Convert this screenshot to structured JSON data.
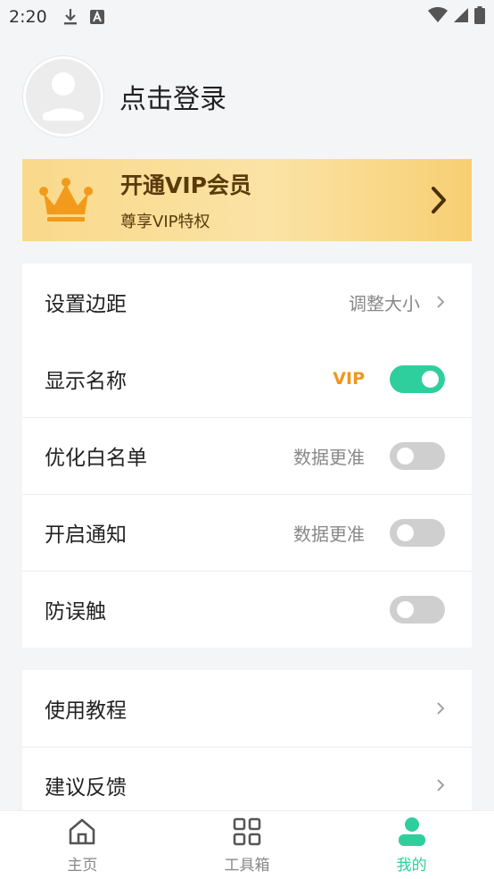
{
  "status_bar": {
    "time": "2:20",
    "icons": [
      "download-icon",
      "a-notification-icon",
      "wifi-icon",
      "signal-icon",
      "battery-icon"
    ]
  },
  "profile": {
    "login_text": "点击登录",
    "avatar_icon": "user-avatar-icon"
  },
  "vip_banner": {
    "title": "开通VIP会员",
    "subtitle": "尊享VIP特权",
    "icon": "crown-icon",
    "crown_color": "#f29a1b"
  },
  "settings": [
    {
      "label": "设置边距",
      "hint": "调整大小",
      "control": "chevron"
    },
    {
      "label": "显示名称",
      "tag": "VIP",
      "control": "toggle",
      "on": true
    },
    {
      "label": "优化白名单",
      "hint": "数据更准",
      "control": "toggle",
      "on": false
    },
    {
      "label": "开启通知",
      "hint": "数据更准",
      "control": "toggle",
      "on": false
    },
    {
      "label": "防误触",
      "control": "toggle",
      "on": false
    }
  ],
  "help": [
    {
      "label": "使用教程",
      "control": "chevron"
    },
    {
      "label": "建议反馈",
      "control": "chevron"
    }
  ],
  "bottom_nav": [
    {
      "label": "主页",
      "icon": "home-icon",
      "active": false
    },
    {
      "label": "工具箱",
      "icon": "grid-icon",
      "active": false
    },
    {
      "label": "我的",
      "icon": "user-icon",
      "active": true
    }
  ],
  "colors": {
    "accent": "#2ecf9c",
    "vip_orange": "#f0961c",
    "background": "#f4f5f7"
  }
}
